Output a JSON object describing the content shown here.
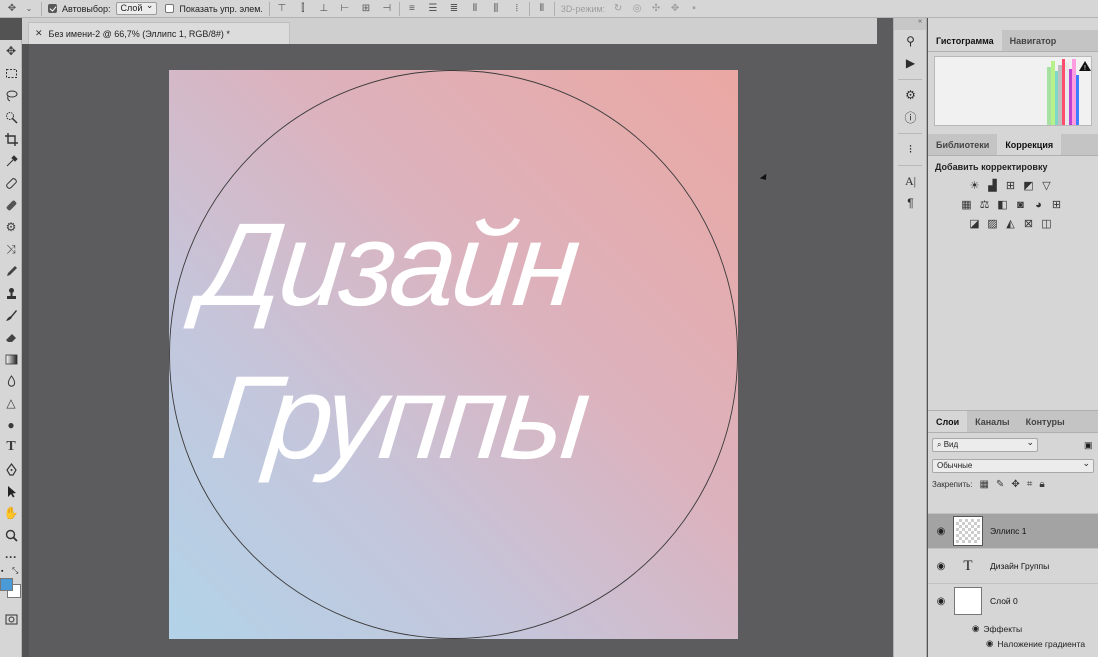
{
  "optbar": {
    "auto_select_label": "Автовыбор:",
    "auto_select_value": "Слой",
    "show_controls_label": "Показать упр. элем.",
    "mode_3d_label": "3D-режим:"
  },
  "document": {
    "tab_title": "Без имени-2 @ 66,7% (Эллипс 1, RGB/8#) *"
  },
  "artwork": {
    "line1": "Дизайн",
    "line2": "Группы"
  },
  "panels": {
    "top_tabs": [
      "Гистограмма",
      "Навигатор"
    ],
    "mid_tabs": [
      "Библиотеки",
      "Коррекция"
    ],
    "correction_title": "Добавить корректировку",
    "layer_tabs": [
      "Слои",
      "Каналы",
      "Контуры"
    ],
    "filter_label": "Вид",
    "blend_mode": "Обычные",
    "lock_label": "Закрепить:"
  },
  "layers": [
    {
      "name": "Эллипс 1",
      "type": "shape",
      "selected": true
    },
    {
      "name": "Дизайн Группы",
      "type": "text",
      "selected": false
    },
    {
      "name": "Слой 0",
      "type": "raster",
      "selected": false
    }
  ],
  "effects": {
    "label": "Эффекты",
    "item": "Наложение градиента"
  },
  "colors": {
    "foreground": "#4a9ad8",
    "background": "#ffffff",
    "gradient_start": "#eba8a3",
    "gradient_end": "#b2d3e8",
    "canvas_bg": "#5c5b5e"
  }
}
